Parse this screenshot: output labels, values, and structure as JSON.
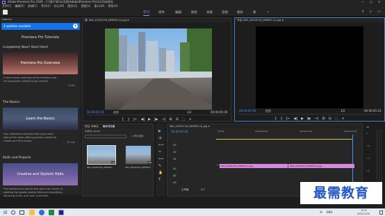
{
  "app": {
    "title": "Adobe Premiere Pro 2020 - C:\\用户\\Eiho\\文档\\Adobe\\Premiere Pro\\14.0\\未命名",
    "window_controls": [
      "—",
      "□",
      "✕"
    ]
  },
  "menubar": [
    "文件(F)",
    "编辑(E)",
    "剪辑(C)",
    "序列(S)",
    "标记(M)",
    "图形(G)",
    "视图(V)",
    "窗口(W)",
    "帮助(H)"
  ],
  "workspaces": {
    "tabs": [
      "学习",
      "组件",
      "编辑",
      "颜色",
      "效果",
      "音频",
      "图形",
      "库"
    ],
    "active": "学习",
    "more": "»"
  },
  "learn_panel": {
    "header": "Learn ≡",
    "updates_label": "4 updates available",
    "title": "Premiere Pro Tutorials",
    "section1": "Completely New? Start Here!",
    "tutorial1": {
      "title": "Premiere Pro Overview",
      "desc": "A two-minute overview of the interface and the essentials needed to get started.",
      "duration": "2 min"
    },
    "section2": "The Basics",
    "tutorial2": {
      "title": "Learn the Basics",
      "desc": "Four interactive tutorials that cover each step of the video editing process needed to create your first movie.",
      "duration": "15 min"
    },
    "section3": "Skills and Projects",
    "tutorial3": {
      "title": "Creative and Stylistic Edits",
      "desc": "Five interactive tutorials that teach the basics of splitting clip speed, adding titles and transitions, adjusting audio, and color correction."
    }
  },
  "source_monitor": {
    "tab": "源: IMG_20200716_065839 (1).jpg ≡",
    "timecode_in": "00:00:05:00",
    "fit": "适合",
    "scale": "1/2",
    "duration": "00:00:05:00"
  },
  "program_monitor": {
    "tab": "节目: IMG_20200716_065839 (1).jpg ≡",
    "timecode": "00:00:05:00",
    "fit": "适合",
    "scale": "1/2",
    "duration": "00:00:05:24"
  },
  "transport_icons": [
    "{",
    "}",
    "|←",
    "◀|",
    "▶",
    "|▶",
    "→|",
    "⊞",
    "⊟",
    "⬚",
    "+"
  ],
  "project_panel": {
    "tabs": [
      "项目: 未命名",
      "媒体浏览器"
    ],
    "sub": "未命名.prproj",
    "count": "2 项已选择",
    "items": [
      {
        "name": "IMG_20200716_065839...",
        "duration": "5:00"
      },
      {
        "name": "IMG_20200716_065839...",
        "duration": "5:00"
      }
    ]
  },
  "timeline": {
    "tab": "IMG_20200716_065839 (1).jpg ≡",
    "timecode": "00:00:05:00",
    "ruler": [
      ":00:00",
      "00:00:05:00",
      "00:00:10:00",
      "00:00:15:00"
    ],
    "video_tracks": [
      "V3",
      "V2",
      "V1"
    ],
    "audio_tracks": [
      "A1",
      "A2",
      "A3"
    ],
    "master": "主声道",
    "master_value": "0.0",
    "clips": [
      "IMG_20200716_065839 (1).jpg",
      "IMG_20200716_065839 (2).jpg"
    ]
  },
  "meters": {
    "label": "dB",
    "scale": [
      "0",
      "-12",
      "-24",
      "-36",
      "-48"
    ],
    "footer": "S S"
  },
  "taskbar": {
    "ime": [
      "中",
      "ENG"
    ],
    "time": "8:12",
    "date": "2021/7/20"
  },
  "watermark": "最需教育",
  "colors": {
    "accent": "#1473e6",
    "clip": "#d48ad8",
    "timecode": "#3d95ff"
  }
}
